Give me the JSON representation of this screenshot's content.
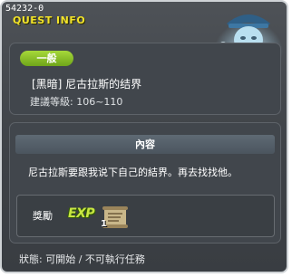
{
  "quest": {
    "id": "54232-0",
    "panel_title": "QUEST INFO",
    "category": "一般",
    "title": "[黑暗] 尼古拉斯的结界",
    "level": "建議等級: 106~110"
  },
  "content": {
    "section_title": "內容",
    "description": "尼古拉斯要跟我说下自己的結界。再去找找他。"
  },
  "reward": {
    "label": "獎勵",
    "exp_text": "EXP",
    "item_count": "1"
  },
  "status": {
    "text": "狀態:  可開始  /  不可執行任務"
  },
  "icons": {
    "npc": "ghost-npc-portrait",
    "reward_item": "scroll-icon"
  },
  "colors": {
    "title_yellow": "#f2e32a",
    "badge_green": "#8cc63f",
    "panel_bg": "#41464c"
  }
}
